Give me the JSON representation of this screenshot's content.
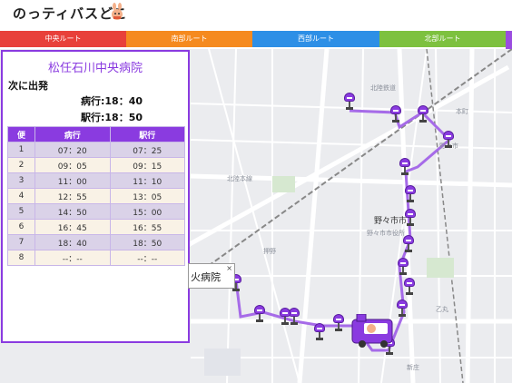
{
  "app": {
    "title": "のっティバスどこ",
    "logo_icon": "mascot-icon"
  },
  "tabs": [
    {
      "label": "中央ルート",
      "color": "#e8403a"
    },
    {
      "label": "南部ルート",
      "color": "#f58a1f"
    },
    {
      "label": "西部ルート",
      "color": "#2d8fe6"
    },
    {
      "label": "北部ルート",
      "color": "#7dc13f"
    },
    {
      "label": "",
      "color": "#9b4de0"
    }
  ],
  "panel": {
    "stop_name": "松任石川中央病院",
    "next_departure_label": "次に出発",
    "next_hospital": "病行:18：40",
    "next_station": "駅行:18：50",
    "table": {
      "headers": [
        "便",
        "病行",
        "駅行"
      ],
      "rows": [
        [
          "1",
          "07：20",
          "07：25"
        ],
        [
          "2",
          "09：05",
          "09：15"
        ],
        [
          "3",
          "11：00",
          "11：10"
        ],
        [
          "4",
          "12：55",
          "13：05"
        ],
        [
          "5",
          "14：50",
          "15：00"
        ],
        [
          "6",
          "16：45",
          "16：55"
        ],
        [
          "7",
          "18：40",
          "18：50"
        ],
        [
          "8",
          "--：--",
          "--：--"
        ]
      ]
    }
  },
  "popup": {
    "text": "火病院",
    "close": "×"
  },
  "map": {
    "labels": {
      "city": "野々市市",
      "city_office": "野々市市役所",
      "l1": "北陸本線",
      "l2": "北陸鉄道",
      "l3": "野々市",
      "l4": "乙丸",
      "l5": "新庄",
      "l6": "押野",
      "l7": "本町"
    }
  },
  "colors": {
    "accent": "#8a3be0",
    "route": "#a66be8"
  }
}
